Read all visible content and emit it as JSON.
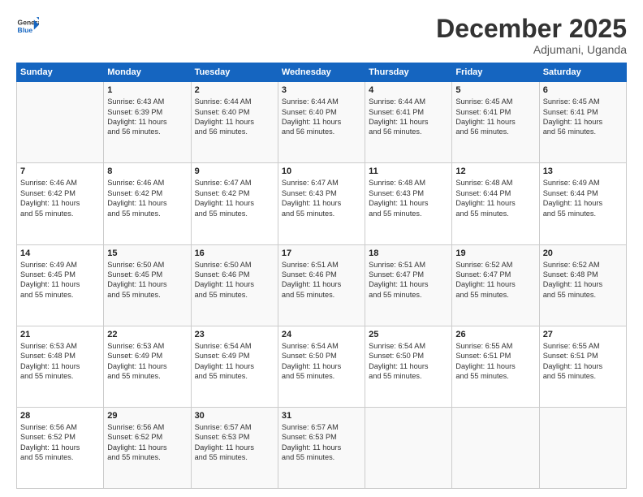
{
  "logo": {
    "line1": "General",
    "line2": "Blue"
  },
  "title": "December 2025",
  "subtitle": "Adjumani, Uganda",
  "columns": [
    "Sunday",
    "Monday",
    "Tuesday",
    "Wednesday",
    "Thursday",
    "Friday",
    "Saturday"
  ],
  "weeks": [
    [
      {
        "day": "",
        "info": ""
      },
      {
        "day": "1",
        "info": "Sunrise: 6:43 AM\nSunset: 6:39 PM\nDaylight: 11 hours\nand 56 minutes."
      },
      {
        "day": "2",
        "info": "Sunrise: 6:44 AM\nSunset: 6:40 PM\nDaylight: 11 hours\nand 56 minutes."
      },
      {
        "day": "3",
        "info": "Sunrise: 6:44 AM\nSunset: 6:40 PM\nDaylight: 11 hours\nand 56 minutes."
      },
      {
        "day": "4",
        "info": "Sunrise: 6:44 AM\nSunset: 6:41 PM\nDaylight: 11 hours\nand 56 minutes."
      },
      {
        "day": "5",
        "info": "Sunrise: 6:45 AM\nSunset: 6:41 PM\nDaylight: 11 hours\nand 56 minutes."
      },
      {
        "day": "6",
        "info": "Sunrise: 6:45 AM\nSunset: 6:41 PM\nDaylight: 11 hours\nand 56 minutes."
      }
    ],
    [
      {
        "day": "7",
        "info": "Sunrise: 6:46 AM\nSunset: 6:42 PM\nDaylight: 11 hours\nand 55 minutes."
      },
      {
        "day": "8",
        "info": "Sunrise: 6:46 AM\nSunset: 6:42 PM\nDaylight: 11 hours\nand 55 minutes."
      },
      {
        "day": "9",
        "info": "Sunrise: 6:47 AM\nSunset: 6:42 PM\nDaylight: 11 hours\nand 55 minutes."
      },
      {
        "day": "10",
        "info": "Sunrise: 6:47 AM\nSunset: 6:43 PM\nDaylight: 11 hours\nand 55 minutes."
      },
      {
        "day": "11",
        "info": "Sunrise: 6:48 AM\nSunset: 6:43 PM\nDaylight: 11 hours\nand 55 minutes."
      },
      {
        "day": "12",
        "info": "Sunrise: 6:48 AM\nSunset: 6:44 PM\nDaylight: 11 hours\nand 55 minutes."
      },
      {
        "day": "13",
        "info": "Sunrise: 6:49 AM\nSunset: 6:44 PM\nDaylight: 11 hours\nand 55 minutes."
      }
    ],
    [
      {
        "day": "14",
        "info": "Sunrise: 6:49 AM\nSunset: 6:45 PM\nDaylight: 11 hours\nand 55 minutes."
      },
      {
        "day": "15",
        "info": "Sunrise: 6:50 AM\nSunset: 6:45 PM\nDaylight: 11 hours\nand 55 minutes."
      },
      {
        "day": "16",
        "info": "Sunrise: 6:50 AM\nSunset: 6:46 PM\nDaylight: 11 hours\nand 55 minutes."
      },
      {
        "day": "17",
        "info": "Sunrise: 6:51 AM\nSunset: 6:46 PM\nDaylight: 11 hours\nand 55 minutes."
      },
      {
        "day": "18",
        "info": "Sunrise: 6:51 AM\nSunset: 6:47 PM\nDaylight: 11 hours\nand 55 minutes."
      },
      {
        "day": "19",
        "info": "Sunrise: 6:52 AM\nSunset: 6:47 PM\nDaylight: 11 hours\nand 55 minutes."
      },
      {
        "day": "20",
        "info": "Sunrise: 6:52 AM\nSunset: 6:48 PM\nDaylight: 11 hours\nand 55 minutes."
      }
    ],
    [
      {
        "day": "21",
        "info": "Sunrise: 6:53 AM\nSunset: 6:48 PM\nDaylight: 11 hours\nand 55 minutes."
      },
      {
        "day": "22",
        "info": "Sunrise: 6:53 AM\nSunset: 6:49 PM\nDaylight: 11 hours\nand 55 minutes."
      },
      {
        "day": "23",
        "info": "Sunrise: 6:54 AM\nSunset: 6:49 PM\nDaylight: 11 hours\nand 55 minutes."
      },
      {
        "day": "24",
        "info": "Sunrise: 6:54 AM\nSunset: 6:50 PM\nDaylight: 11 hours\nand 55 minutes."
      },
      {
        "day": "25",
        "info": "Sunrise: 6:54 AM\nSunset: 6:50 PM\nDaylight: 11 hours\nand 55 minutes."
      },
      {
        "day": "26",
        "info": "Sunrise: 6:55 AM\nSunset: 6:51 PM\nDaylight: 11 hours\nand 55 minutes."
      },
      {
        "day": "27",
        "info": "Sunrise: 6:55 AM\nSunset: 6:51 PM\nDaylight: 11 hours\nand 55 minutes."
      }
    ],
    [
      {
        "day": "28",
        "info": "Sunrise: 6:56 AM\nSunset: 6:52 PM\nDaylight: 11 hours\nand 55 minutes."
      },
      {
        "day": "29",
        "info": "Sunrise: 6:56 AM\nSunset: 6:52 PM\nDaylight: 11 hours\nand 55 minutes."
      },
      {
        "day": "30",
        "info": "Sunrise: 6:57 AM\nSunset: 6:53 PM\nDaylight: 11 hours\nand 55 minutes."
      },
      {
        "day": "31",
        "info": "Sunrise: 6:57 AM\nSunset: 6:53 PM\nDaylight: 11 hours\nand 55 minutes."
      },
      {
        "day": "",
        "info": ""
      },
      {
        "day": "",
        "info": ""
      },
      {
        "day": "",
        "info": ""
      }
    ]
  ]
}
